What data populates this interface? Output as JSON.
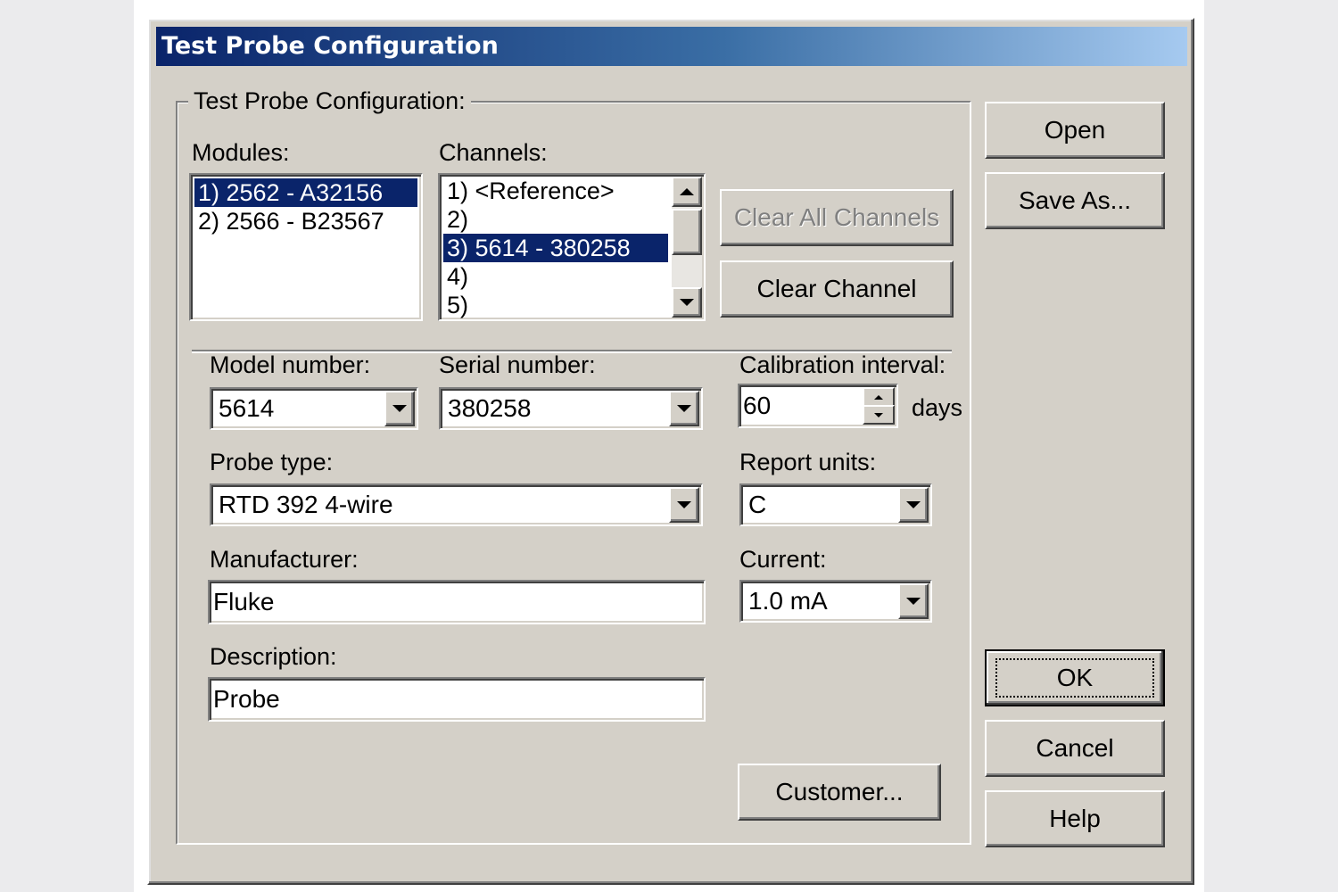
{
  "window": {
    "title": "Test Probe Configuration"
  },
  "group": {
    "label": "Test Probe Configuration:"
  },
  "modules": {
    "label": "Modules:",
    "items": [
      "1) 2562 - A32156",
      "2) 2566 - B23567"
    ],
    "selected_index": 0
  },
  "channels": {
    "label": "Channels:",
    "items": [
      "1) <Reference>",
      "2)",
      "3) 5614 - 380258",
      "4)",
      "5)"
    ],
    "selected_index": 2
  },
  "buttons": {
    "clear_all_channels": "Clear All Channels",
    "clear_channel": "Clear Channel",
    "open": "Open",
    "save_as": "Save As...",
    "ok": "OK",
    "cancel": "Cancel",
    "help": "Help",
    "customer": "Customer..."
  },
  "fields": {
    "model_number": {
      "label": "Model number:",
      "value": "5614"
    },
    "serial_number": {
      "label": "Serial number:",
      "value": "380258"
    },
    "calibration_interval": {
      "label": "Calibration interval:",
      "value": "60",
      "unit": "days"
    },
    "probe_type": {
      "label": "Probe type:",
      "value": "RTD 392 4-wire"
    },
    "report_units": {
      "label": "Report units:",
      "value": "C"
    },
    "manufacturer": {
      "label": "Manufacturer:",
      "value": "Fluke"
    },
    "current": {
      "label": "Current:",
      "value": "1.0 mA"
    },
    "description": {
      "label": "Description:",
      "value": "Probe"
    }
  },
  "colors": {
    "dialog_face": "#d4d0c8",
    "selection": "#0a246a",
    "title_gradient_start": "#0a246a",
    "title_gradient_end": "#a6caf0"
  }
}
